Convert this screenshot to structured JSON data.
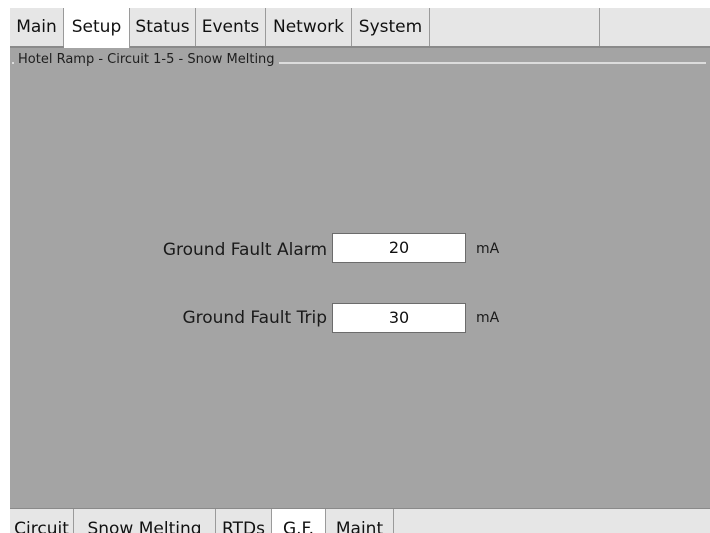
{
  "top_tabs": {
    "items": [
      {
        "label": "Main"
      },
      {
        "label": "Setup"
      },
      {
        "label": "Status"
      },
      {
        "label": "Events"
      },
      {
        "label": "Network"
      },
      {
        "label": "System"
      }
    ],
    "active": "Setup"
  },
  "group": {
    "title": "Hotel Ramp - Circuit 1-5 - Snow Melting"
  },
  "fields": {
    "alarm": {
      "label": "Ground Fault Alarm",
      "value": "20",
      "unit": "mA"
    },
    "trip": {
      "label": "Ground Fault Trip",
      "value": "30",
      "unit": "mA"
    }
  },
  "bottom_tabs": {
    "items": [
      {
        "label": "Circuit"
      },
      {
        "label": "Snow Melting"
      },
      {
        "label": "RTDs"
      },
      {
        "label": "G.F."
      },
      {
        "label": "Maint"
      }
    ],
    "active": "G.F."
  },
  "colors": {
    "panel_background": "#a4a4a4",
    "tab_background": "#e6e6e6",
    "active_tab": "#ffffff"
  }
}
